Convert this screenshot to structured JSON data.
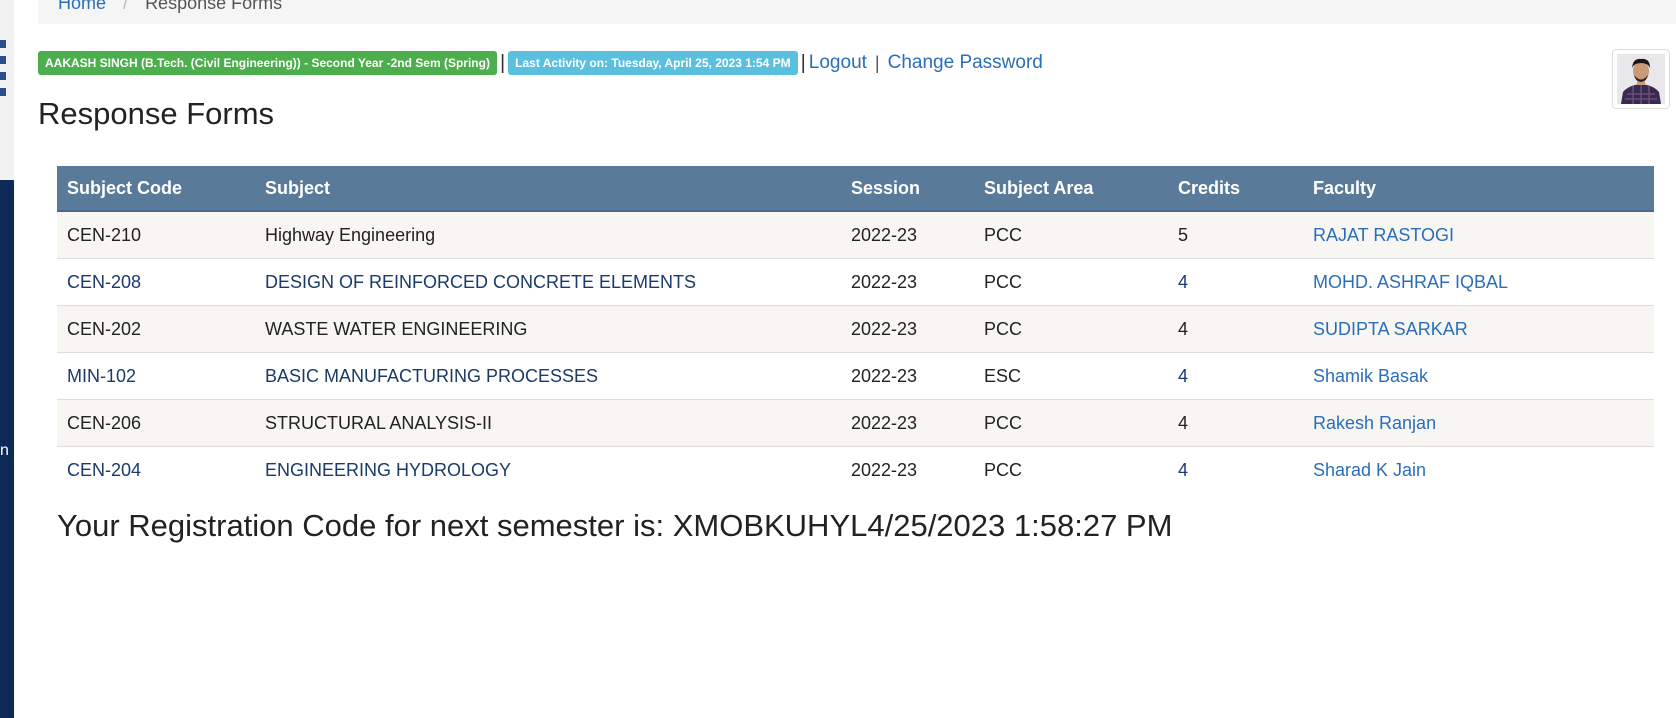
{
  "breadcrumb": {
    "home": "Home",
    "current": "Response Forms"
  },
  "left_rail": {
    "edge_text": "n"
  },
  "status": {
    "student_badge": "AAKASH SINGH (B.Tech. (Civil Engineering)) - Second Year -2nd Sem (Spring)",
    "activity_badge": "Last Activity on: Tuesday, April 25, 2023 1:54 PM",
    "separator": "|",
    "logout": "Logout",
    "change_password": "Change Password"
  },
  "colors": {
    "badge_green": "#4cae4c",
    "badge_blue": "#5bc0de",
    "table_header": "#5a7a9a",
    "link": "#2a6ebb",
    "sidebar_dark": "#0d2a57"
  },
  "page": {
    "title": "Response Forms"
  },
  "table": {
    "headers": [
      "Subject Code",
      "Subject",
      "Session",
      "Subject Area",
      "Credits",
      "Faculty"
    ],
    "rows": [
      [
        "CEN-210",
        "Highway Engineering",
        "2022-23",
        "PCC",
        "5",
        "RAJAT RASTOGI"
      ],
      [
        "CEN-208",
        "DESIGN OF REINFORCED CONCRETE ELEMENTS",
        "2022-23",
        "PCC",
        "4",
        "MOHD. ASHRAF IQBAL"
      ],
      [
        "CEN-202",
        "WASTE WATER ENGINEERING",
        "2022-23",
        "PCC",
        "4",
        "SUDIPTA SARKAR"
      ],
      [
        "MIN-102",
        "BASIC MANUFACTURING PROCESSES",
        "2022-23",
        "ESC",
        "4",
        "Shamik Basak"
      ],
      [
        "CEN-206",
        "STRUCTURAL ANALYSIS-II",
        "2022-23",
        "PCC",
        "4",
        "Rakesh Ranjan"
      ],
      [
        "CEN-204",
        "ENGINEERING HYDROLOGY",
        "2022-23",
        "PCC",
        "4",
        "Sharad K Jain"
      ]
    ]
  },
  "registration": {
    "text": "Your Registration Code for next semester is: XMOBKUHYL4/25/2023 1:58:27 PM"
  },
  "icons": {
    "avatar": "user-avatar-photo",
    "sidebar_logo": "institute-logo-fragment"
  }
}
